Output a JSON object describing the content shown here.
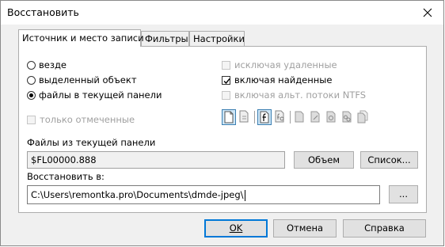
{
  "window": {
    "title": "Восстановить"
  },
  "tabs": [
    {
      "label": "Источник и место записи",
      "active": true
    },
    {
      "label": "Фильтры",
      "active": false
    },
    {
      "label": "Настройки",
      "active": false
    }
  ],
  "source": {
    "radios": [
      {
        "label": "везде",
        "selected": false
      },
      {
        "label": "выделенный объект",
        "selected": false
      },
      {
        "label": "файлы в текущей панели",
        "selected": true
      }
    ],
    "only_marked": {
      "label": "только отмеченные",
      "checked": false,
      "enabled": false
    }
  },
  "options": {
    "exclude_deleted": {
      "label": "исключая удаленные",
      "checked": false,
      "enabled": false
    },
    "include_found": {
      "label": "включая найденные",
      "checked": true,
      "enabled": true
    },
    "include_ntfs": {
      "label": "включая альт. потоки NTFS",
      "checked": false,
      "enabled": false
    }
  },
  "icons": [
    "file-icon",
    "file-plain-icon",
    "file-f-icon",
    "file-f-gear-icon",
    "doc-icon",
    "doc-edit-icon",
    "doc-gear-icon",
    "doc-gears-icon",
    "doc-multi-icon"
  ],
  "files_panel": {
    "label": "Файлы из текущей панели",
    "value": "$FL00000.888",
    "volume_button": "Объем",
    "list_button": "Список..."
  },
  "restore_to": {
    "label": "Восстановить в:",
    "value": "C:\\Users\\remontka.pro\\Documents\\dmde-jpeg\\",
    "browse_button": "..."
  },
  "footer": {
    "ok": "OK",
    "cancel": "Отмена",
    "help": "Справка"
  },
  "colors": {
    "accent": "#0078d7",
    "selected_icon_bg": "#cde6f7"
  }
}
